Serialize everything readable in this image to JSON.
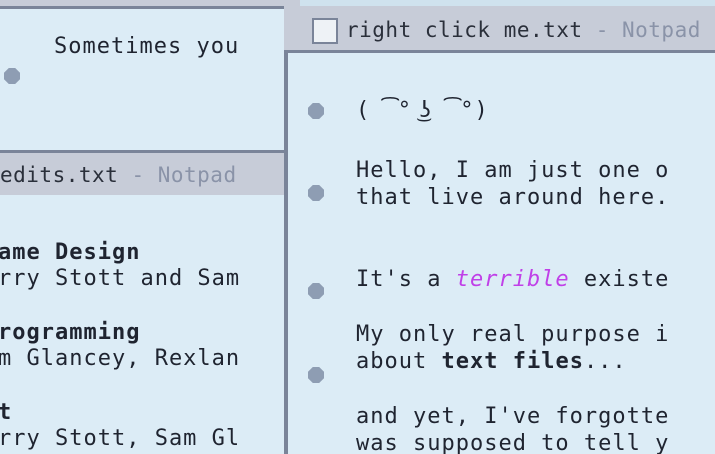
{
  "back_window": {
    "line": "Sometimes you"
  },
  "credits_window": {
    "title": "edits.txt",
    "title_app": " - Notpad",
    "lines": [
      {
        "text": "ame Design",
        "bold": true
      },
      {
        "text": "rry Stott and Sam",
        "bold": false
      },
      {
        "text": "rogramming",
        "bold": true
      },
      {
        "text": "m Glancey, Rexlan",
        "bold": false
      },
      {
        "text": "t",
        "bold": true
      },
      {
        "text": "rry Stott, Sam Gl",
        "bold": false
      }
    ]
  },
  "main_window": {
    "title": "right click me.txt",
    "title_app": " - Notpad",
    "face": "( ͡° ͜ʖ ͡°)",
    "para1": [
      "Hello, I am just one o",
      "that live around here."
    ],
    "para2_prefix": "It's a ",
    "para2_accent": "terrible",
    "para2_suffix": " existe",
    "para3_line1": "My only real purpose i",
    "para3_line2_prefix": "about ",
    "para3_line2_bold": "text files",
    "para3_line2_suffix": "...",
    "para4": [
      "and yet, I've forgotte",
      "was supposed to tell y"
    ]
  }
}
